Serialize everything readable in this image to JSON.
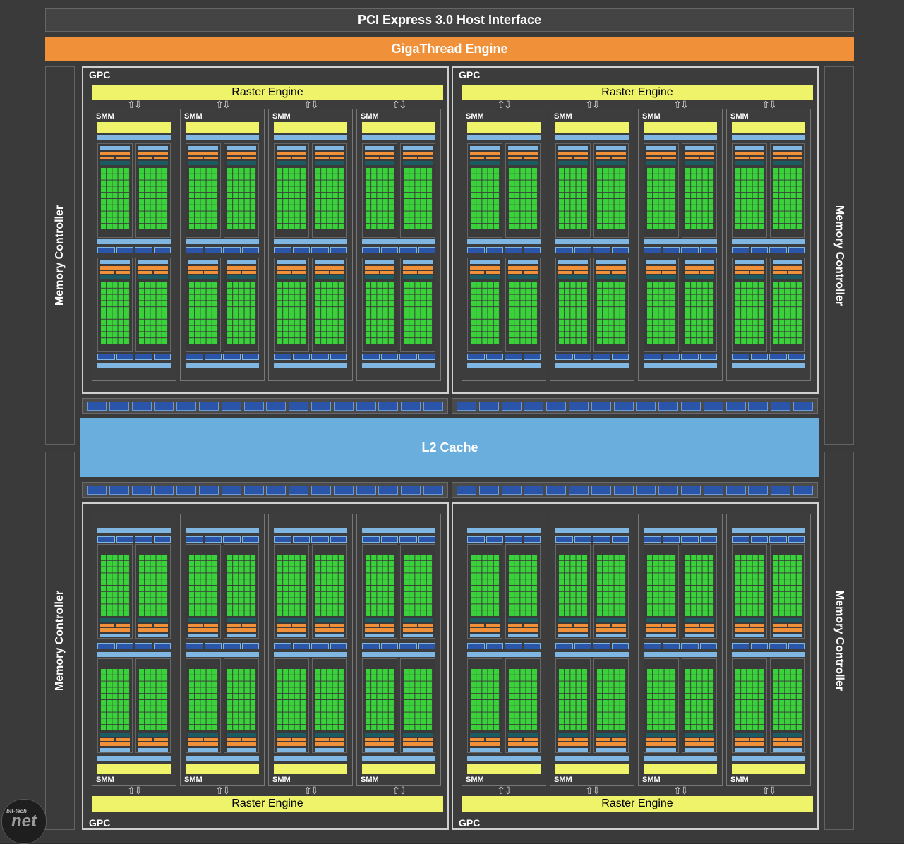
{
  "header": {
    "pci_label": "PCI Express 3.0 Host Interface",
    "giga_label": "GigaThread Engine"
  },
  "memory_controller_label": "Memory Controller",
  "l2_label": "L2 Cache",
  "gpc_label": "GPC",
  "raster_label": "Raster Engine",
  "smm_label": "SMM",
  "logo": {
    "small": "bit-tech",
    "big": "net"
  },
  "colors": {
    "orange": "#f0913a",
    "yellow": "#eef36a",
    "l2_blue": "#6aaedd",
    "core_green": "#3ad23a",
    "dark_blue": "#2a55a8"
  }
}
